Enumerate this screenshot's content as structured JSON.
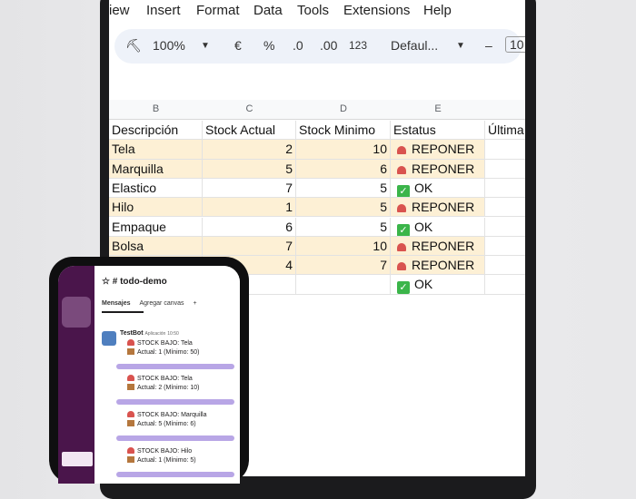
{
  "menu": [
    "iew",
    "Insert",
    "Format",
    "Data",
    "Tools",
    "Extensions",
    "Help"
  ],
  "toolbar": {
    "zoom": "100%",
    "currency": "€",
    "percent": "%",
    "dec_less": ".0",
    "dec_more": ".00",
    "format_123": "123",
    "font": "Defaul...",
    "minus": "–",
    "font_size": "10"
  },
  "columns": [
    "B",
    "C",
    "D",
    "E"
  ],
  "header": [
    "Descripción",
    "Stock Actual",
    "Stock Minimo",
    "Estatus",
    "Última"
  ],
  "rows": [
    {
      "desc": "Tela",
      "actual": "2",
      "min": "10",
      "status": "REPONER",
      "hl": true
    },
    {
      "desc": "Marquilla",
      "actual": "5",
      "min": "6",
      "status": "REPONER",
      "hl": true
    },
    {
      "desc": "Elastico",
      "actual": "7",
      "min": "5",
      "status": "OK",
      "hl": false
    },
    {
      "desc": "Hilo",
      "actual": "1",
      "min": "5",
      "status": "REPONER",
      "hl": true
    },
    {
      "desc": "Empaque",
      "actual": "6",
      "min": "5",
      "status": "OK",
      "hl": false
    },
    {
      "desc": "Bolsa",
      "actual": "7",
      "min": "10",
      "status": "REPONER",
      "hl": true
    },
    {
      "desc": "",
      "actual": "4",
      "min": "7",
      "status": "REPONER",
      "hl": true
    },
    {
      "desc": "",
      "actual": "",
      "min": "",
      "status": "OK",
      "hl": false
    }
  ],
  "slack": {
    "channel": "# todo-demo",
    "tab_messages": "Mensajes",
    "tab_canvas": "Agregar canvas",
    "tab_add": "+",
    "bot_name": "TestBot",
    "bot_tag": "Aplicación",
    "bot_time": "10:50",
    "messages": [
      {
        "title": "STOCK BAJO: Tela",
        "detail": "Actual: 1 (Mínimo: 50)"
      },
      {
        "title": "STOCK BAJO: Tela",
        "detail": "Actual: 2 (Mínimo: 10)"
      },
      {
        "title": "STOCK BAJO: Marquilla",
        "detail": "Actual: 5 (Mínimo: 6)"
      },
      {
        "title": "STOCK BAJO: Hilo",
        "detail": "Actual: 1 (Mínimo: 5)"
      }
    ]
  }
}
